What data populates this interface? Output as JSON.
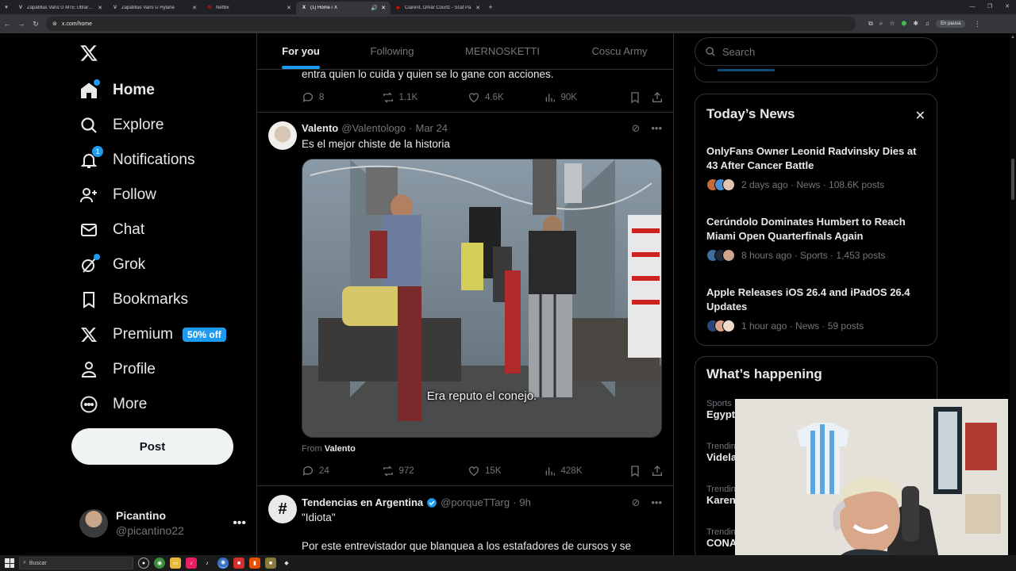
{
  "browser": {
    "tabs": [
      {
        "favicon": "V",
        "label": "Zapatillas Vans U MTE Ultrarange",
        "color": "#ffffff",
        "active": false
      },
      {
        "favicon": "V",
        "label": "Zapatillas Vans U Hylane",
        "color": "#ffffff",
        "active": false
      },
      {
        "favicon": "N",
        "label": "Netflix",
        "color": "#e50914",
        "active": false
      },
      {
        "favicon": "X",
        "label": "(1) Home / X",
        "color": "#ffffff",
        "active": true
      },
      {
        "favicon": "▶",
        "label": "Clarent, Omar Courtz - Scat Pa",
        "color": "#ff0000",
        "active": false
      }
    ],
    "new_tab": "+",
    "url": "x.com/home",
    "paused_label": "En pausa"
  },
  "nav": {
    "items": [
      {
        "label": "Home",
        "icon": "home-icon"
      },
      {
        "label": "Explore",
        "icon": "search-icon"
      },
      {
        "label": "Notifications",
        "icon": "bell-icon",
        "badge": "1"
      },
      {
        "label": "Follow",
        "icon": "add-user-icon"
      },
      {
        "label": "Chat",
        "icon": "mail-icon"
      },
      {
        "label": "Grok",
        "icon": "grok-icon"
      },
      {
        "label": "Bookmarks",
        "icon": "bookmark-icon"
      },
      {
        "label": "Premium",
        "icon": "x-logo-icon",
        "pill": "50% off"
      },
      {
        "label": "Profile",
        "icon": "person-icon"
      },
      {
        "label": "More",
        "icon": "more-circle-icon"
      }
    ],
    "post_label": "Post",
    "account": {
      "name": "Picantino",
      "handle": "@picantino22",
      "more": "•••"
    }
  },
  "feed": {
    "tabs": [
      "For you",
      "Following",
      "MERNOSKETTI",
      "Coscu Army"
    ],
    "active_tab": "For you",
    "previous_tweet": {
      "text_tail": "entra quien lo cuida y quien se lo gane con acciones.",
      "replies": "8",
      "reposts": "1.1K",
      "likes": "4.6K",
      "views": "90K"
    },
    "tweet": {
      "name": "Valento",
      "handle": "@Valentologo",
      "date": "Mar 24",
      "text": "Es el mejor chiste de la historia",
      "video_subtitle": "Era reputo el conejo.",
      "from_prefix": "From",
      "from_name": "Valento",
      "replies": "24",
      "reposts": "972",
      "likes": "15K",
      "views": "428K"
    },
    "next_tweet": {
      "name": "Tendencias en Argentina",
      "handle": "@porqueTTarg",
      "date": "9h",
      "line1": "\"Idiota\"",
      "line2": "Por este entrevistador que blanquea a los estafadores de cursos y se"
    }
  },
  "sidebar": {
    "search_placeholder": "Search",
    "news_title": "Today’s News",
    "news": [
      {
        "title": "OnlyFans Owner Leonid Radvinsky Dies at 43 After Cancer Battle",
        "meta": "2 days ago · News · 108.6K posts"
      },
      {
        "title": "Cerúndolo Dominates Humbert to Reach Miami Open Quarterfinals Again",
        "meta": "8 hours ago · Sports · 1,453 posts"
      },
      {
        "title": "Apple Releases iOS 26.4 and iPadOS 26.4 Updates",
        "meta": "1 hour ago · News · 59 posts"
      }
    ],
    "happening_title": "What’s happening",
    "trends": [
      {
        "category": "Sports",
        "name": "Egypt"
      },
      {
        "category": "Trendin",
        "name": "Videla"
      },
      {
        "category": "Trendin",
        "name": "Karen"
      },
      {
        "category": "Trendin",
        "name": "CONA"
      }
    ]
  },
  "taskbar": {
    "search_label": "Buscar"
  },
  "colors": {
    "accent": "#1d9bf0",
    "background": "#000000",
    "border": "#2f3336",
    "muted": "#71767b"
  }
}
